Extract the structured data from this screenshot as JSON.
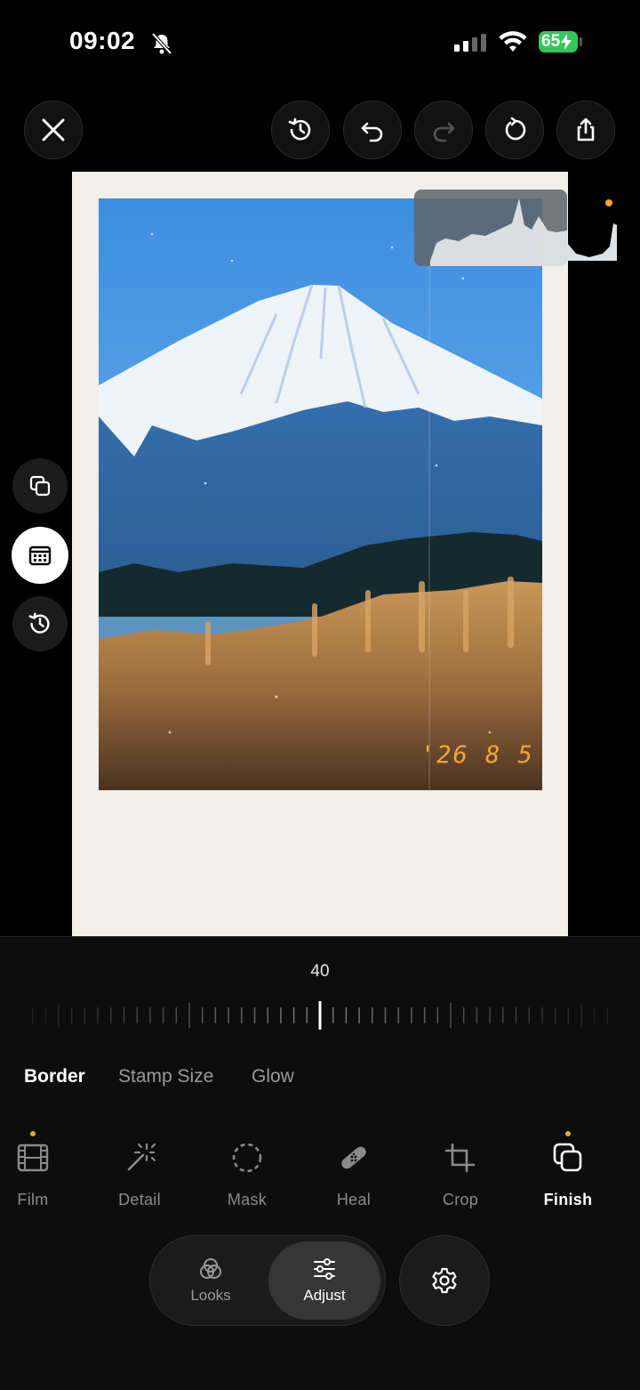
{
  "status_bar": {
    "time": "09:02",
    "battery": "65"
  },
  "photo": {
    "date_stamp": "'26 8 5"
  },
  "slider": {
    "value": "40"
  },
  "finish_options": [
    {
      "label": "Border",
      "active": true
    },
    {
      "label": "Stamp Size",
      "active": false
    },
    {
      "label": "Glow",
      "active": false
    }
  ],
  "tools": [
    {
      "label": "Film",
      "icon": "film-icon",
      "dot": true
    },
    {
      "label": "Detail",
      "icon": "magic-wand-icon",
      "dot": false
    },
    {
      "label": "Mask",
      "icon": "mask-icon",
      "dot": false
    },
    {
      "label": "Heal",
      "icon": "bandage-icon",
      "dot": false
    },
    {
      "label": "Crop",
      "icon": "crop-icon",
      "dot": false
    },
    {
      "label": "Finish",
      "icon": "layers-icon",
      "dot": true,
      "active": true
    }
  ],
  "mode_switch": {
    "looks": "Looks",
    "adjust": "Adjust",
    "active": "Adjust"
  },
  "colors": {
    "accent_dot": "#f0a531",
    "battery": "#35c759",
    "frame": "#f1efea",
    "stamp": "#f2a53a"
  }
}
